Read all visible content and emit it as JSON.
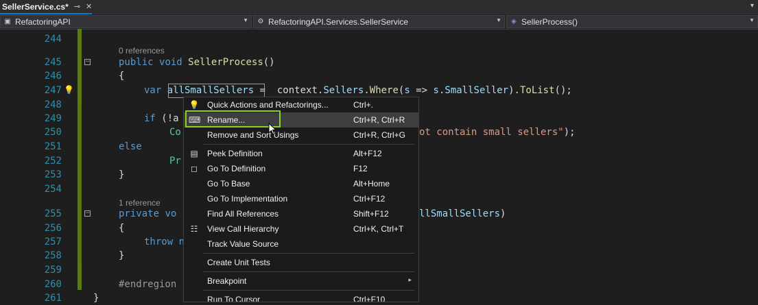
{
  "tab": {
    "title": "SellerService.cs*",
    "pin": "⊸",
    "close": "✕",
    "overflow": "▾"
  },
  "nav": {
    "project": "RefactoringAPI",
    "type": "RefactoringAPI.Services.SellerService",
    "member": "SellerProcess()"
  },
  "editor": {
    "line_numbers": [
      "244",
      "245",
      "246",
      "247",
      "248",
      "249",
      "250",
      "251",
      "252",
      "253",
      "254",
      "255",
      "256",
      "257",
      "258",
      "259",
      "260",
      "261"
    ],
    "refs": [
      "0 references",
      "1 reference"
    ],
    "code": {
      "l245_kw1": "public",
      "l245_kw2": "void",
      "l245_fn": "SellerProcess",
      "l245_rest": "()",
      "l246": "{",
      "l247_kw": "var ",
      "l247_var": "allSmallSellers",
      "l247_a": " =  context.",
      "l247_b": "Sellers",
      "l247_c": ".",
      "l247_d": "Where",
      "l247_e": "(",
      "l247_f": "s",
      "l247_g": " => ",
      "l247_h": "s",
      "l247_i": ".",
      "l247_j": "SmallSeller",
      "l247_k": ").",
      "l247_l": "ToList",
      "l247_m": "();",
      "l249_kw": "if",
      "l249_rest": " (!a",
      "l250_a": "Co",
      "l250_str": "ot contain small sellers\"",
      "l250_end": ");",
      "l251": "else",
      "l252": "Pr",
      "l253": "}",
      "l255_kw": "private",
      "l255_rest": " vo",
      "l255_param": "llSmallSellers",
      "l255_end": ")",
      "l256": "{",
      "l257": "throw",
      "l257_rest": " n",
      "l258": "}",
      "l260": "#endregion",
      "l261": "}"
    }
  },
  "menu": {
    "items": [
      {
        "icon": "lightbulb-icon",
        "glyph": "💡",
        "label": "Quick Actions and Refactorings...",
        "shortcut": "Ctrl+."
      },
      {
        "icon": "rename-icon",
        "glyph": "⌨",
        "label": "Rename...",
        "shortcut": "Ctrl+R, Ctrl+R"
      },
      {
        "icon": "",
        "glyph": "",
        "label": "Remove and Sort Usings",
        "shortcut": "Ctrl+R, Ctrl+G"
      },
      {
        "icon": "peek-definition-icon",
        "glyph": "▤",
        "label": "Peek Definition",
        "shortcut": "Alt+F12"
      },
      {
        "icon": "go-to-definition-icon",
        "glyph": "◻",
        "label": "Go To Definition",
        "shortcut": "F12"
      },
      {
        "icon": "",
        "glyph": "",
        "label": "Go To Base",
        "shortcut": "Alt+Home"
      },
      {
        "icon": "",
        "glyph": "",
        "label": "Go To Implementation",
        "shortcut": "Ctrl+F12"
      },
      {
        "icon": "",
        "glyph": "",
        "label": "Find All References",
        "shortcut": "Shift+F12"
      },
      {
        "icon": "call-hierarchy-icon",
        "glyph": "☷",
        "label": "View Call Hierarchy",
        "shortcut": "Ctrl+K, Ctrl+T"
      },
      {
        "icon": "",
        "glyph": "",
        "label": "Track Value Source",
        "shortcut": ""
      },
      {
        "icon": "",
        "glyph": "",
        "label": "Create Unit Tests",
        "shortcut": ""
      },
      {
        "icon": "",
        "glyph": "",
        "label": "Breakpoint",
        "shortcut": "",
        "submenu_glyph": "▸"
      },
      {
        "icon": "",
        "glyph": "",
        "label": "Run To Cursor",
        "shortcut": "Ctrl+F10"
      }
    ]
  },
  "colors": {
    "accent": "#007acc",
    "highlight": "#8ad21b",
    "changed_margin": "#587c0c"
  }
}
